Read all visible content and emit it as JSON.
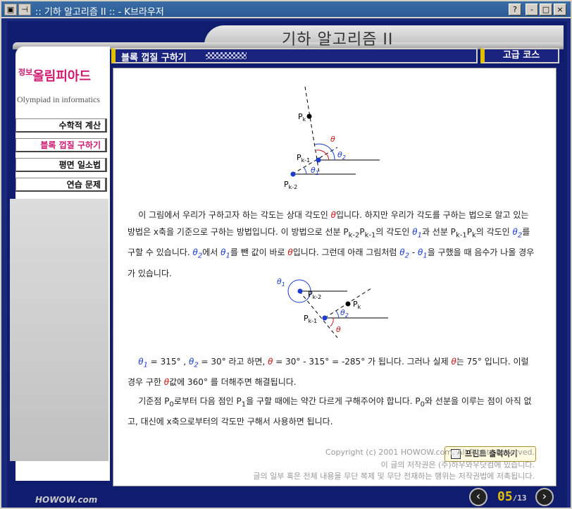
{
  "window": {
    "title": ":: 기하 알고리즘 II :: - K브라우저",
    "buttons": [
      "?",
      "-",
      "□",
      "×"
    ]
  },
  "header": {
    "title": "기하 알고리즘 II"
  },
  "sidebar": {
    "logo_small": "정보",
    "logo_main": "올림피아드",
    "logo_en": "Olympiad in informatics",
    "items": [
      {
        "label": "수학적 계산",
        "active": false
      },
      {
        "label": "블록 껍질 구하기",
        "active": true
      },
      {
        "label": "평면 일소법",
        "active": false
      },
      {
        "label": "연습 문제",
        "active": false
      }
    ]
  },
  "section": {
    "title": "블록 껍질 구하기",
    "level": "고급 코스"
  },
  "figure1": {
    "pk": "P",
    "pk_sub": "k",
    "pk1": "P",
    "pk1_sub": "k-1",
    "pk2": "P",
    "pk2_sub": "k-2",
    "theta": "θ",
    "theta1": "θ",
    "theta1_sub": "1",
    "theta2": "θ",
    "theta2_sub": "2"
  },
  "figure2": {
    "theta1": "θ",
    "theta1_sub": "1",
    "pk2": "P",
    "pk2_sub": "k-2",
    "pk": "P",
    "pk_sub": "k",
    "pk1": "P",
    "pk1_sub": "k-1",
    "theta2": "θ",
    "theta2_sub": "2",
    "theta": "θ"
  },
  "paragraphs": {
    "p1_a": "이 그림에서 우리가 구하고자 하는 각도는 상대 각도인 ",
    "p1_b": "입니다. 하지만 우리가 각도를 구하는 법으로 알고 있는 방법은 x축을 기준으로 구하는 방법입니다. 이 방법으로 선분 P",
    "p1_c": "k-2",
    "p1_d": "P",
    "p1_e": "k-1",
    "p1_f": "의 각도인 ",
    "p1_g": "과 선분 P",
    "p1_h": "k-1",
    "p1_i": "P",
    "p1_j": "k",
    "p1_k": "의 각도인 ",
    "p1_l": "를 구할 수 있습니다. ",
    "p1_m": "에서 ",
    "p1_n": "를 뺀 값이 바로 ",
    "p1_o": "입니다. 그런데 아래 그림처럼 ",
    "p1_p": " - ",
    "p1_q": "을 구했을 때 음수가 나올 경우가 있습니다.",
    "p2_a": " = 315° , ",
    "p2_b": " = 30° 라고 하면, ",
    "p2_c": " = 30°  - 315°  = -285° 가 됩니다. 그러나 실제 ",
    "p2_d": "는 75° 입니다. 이럴 경우 구한 ",
    "p2_e": "값에 360° 를 더해주면 해결됩니다.",
    "p3_a": "기준점 P",
    "p3_b": "0",
    "p3_c": "로부터 다음 점인 P",
    "p3_d": "1",
    "p3_e": "을 구할 때에는 약간 다르게 구해주어야 합니다. P",
    "p3_f": "0",
    "p3_g": "와 선분을 이루는 점이 아직 없고, 대신에 x축으로부터의 각도만 구해서 사용하면 됩니다.",
    "theta": "θ",
    "theta1": "θ",
    "theta1_sub": "1",
    "theta2": "θ",
    "theta2_sub": "2"
  },
  "print_button": "프린트 출력하기",
  "copyright": [
    "Copyright (c) 2001 HOWOW.com. All Rights Reserved.",
    "이 글의 저작권은 (주)하우와우닷컴에 있습니다.",
    "글의 일부 혹은 전체 내용을 무단 복제 및 무단 전재하는 행위는 저작권법에 저촉됩니다."
  ],
  "footer_logo": "HOWOW.com",
  "pager": {
    "current": "05",
    "total": "/13",
    "prev": "‹",
    "next": "›"
  }
}
